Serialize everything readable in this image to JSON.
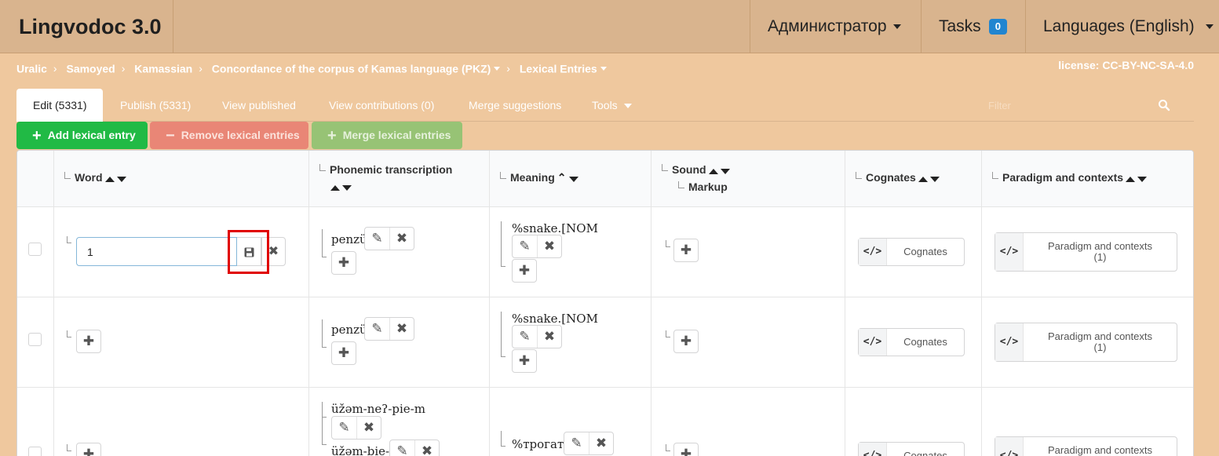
{
  "app": {
    "title": "Lingvodoc 3.0",
    "user_menu": "Администратор",
    "tasks_label": "Tasks",
    "tasks_count": "0",
    "languages_menu": "Languages (English)"
  },
  "breadcrumb": [
    "Uralic",
    "Samoyed",
    "Kamassian",
    "Concordance of the corpus of Kamas language (PKZ)",
    "Lexical Entries"
  ],
  "license": "license: CC-BY-NC-SA-4.0",
  "tabs": [
    "Edit (5331)",
    "Publish (5331)",
    "View published",
    "View contributions (0)",
    "Merge suggestions",
    "Tools"
  ],
  "filter_placeholder": "Filter",
  "actions": {
    "add": "Add lexical entry",
    "remove": "Remove lexical entries",
    "merge": "Merge lexical entries"
  },
  "columns": {
    "word": "Word",
    "phonemic": "Phonemic transcription",
    "meaning": "Meaning",
    "sound": "Sound",
    "markup": "Markup",
    "cognates": "Cognates",
    "paradigm": "Paradigm and contexts"
  },
  "rows": [
    {
      "word_input_value": "1",
      "phonemic": [
        "penzü"
      ],
      "meaning": [
        "%snake.[NOM"
      ],
      "cognates": "Cognates",
      "paradigm_line1": "Paradigm and contexts",
      "paradigm_line2": "(1)"
    },
    {
      "phonemic": [
        "penzü"
      ],
      "meaning": [
        "%snake.[NOM"
      ],
      "cognates": "Cognates",
      "paradigm_line1": "Paradigm and contexts",
      "paradigm_line2": "(1)"
    },
    {
      "phonemic": [
        "üžəm-neʔ-pie-m",
        "üžəm-bie-l"
      ],
      "meaning": [
        "%трогать"
      ],
      "cognates": "Cognates",
      "paradigm_line1": "Paradigm and contexts"
    }
  ],
  "icons": {
    "edit": "edit-icon",
    "delete": "close-icon",
    "add": "plus-icon",
    "save": "save-icon",
    "code": "code-icon",
    "search": "search-icon"
  },
  "colors": {
    "background": "#efc89e",
    "topbar": "#d9b48e",
    "add_button": "#21ba45",
    "remove_button": "#e98676",
    "merge_button": "#97c375",
    "badge": "#2185d0",
    "highlight": "#e00000"
  }
}
